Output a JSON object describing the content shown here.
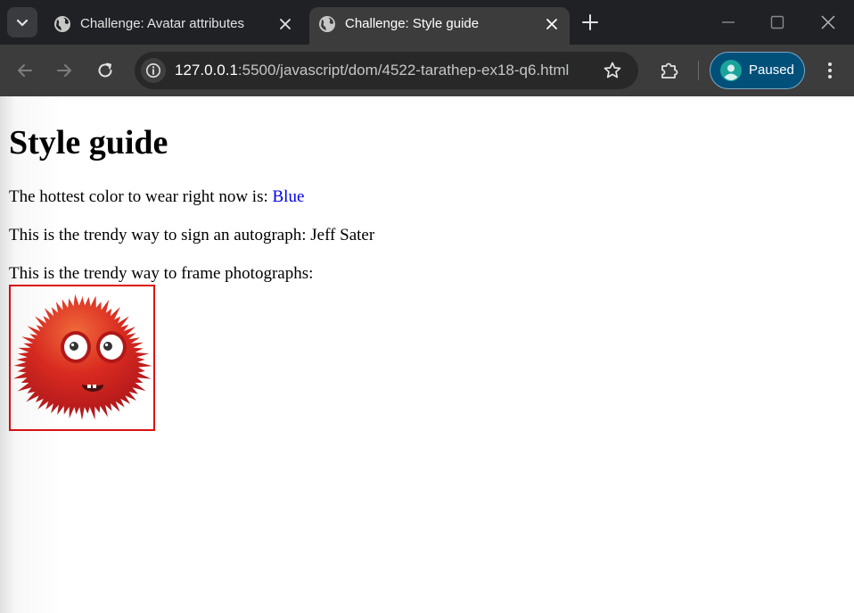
{
  "browser": {
    "tabs": [
      {
        "title": "Challenge: Avatar attributes",
        "active": false
      },
      {
        "title": "Challenge: Style guide",
        "active": true
      }
    ],
    "address": {
      "host": "127.0.0.1",
      "path": ":5500/javascript/dom/4522-tarathep-ex18-q6.html"
    },
    "profile_label": "Paused",
    "icons": [
      "tab-search-icon",
      "globe-icon",
      "close-icon",
      "plus-icon",
      "minimize-icon",
      "maximize-icon",
      "back-icon",
      "forward-icon",
      "reload-icon",
      "site-info-icon",
      "star-icon",
      "puzzle-icon",
      "person-icon",
      "kebab-menu-icon"
    ]
  },
  "page": {
    "heading": "Style guide",
    "color_text": "The hottest color to wear right now is: ",
    "color_value": "Blue",
    "autograph_text": "This is the trendy way to sign an autograph: Jeff Sater",
    "frame_text": "This is the trendy way to frame photographs:",
    "colors": {
      "hot_color": "#0000ee",
      "frame_border": "#dd1111"
    }
  }
}
